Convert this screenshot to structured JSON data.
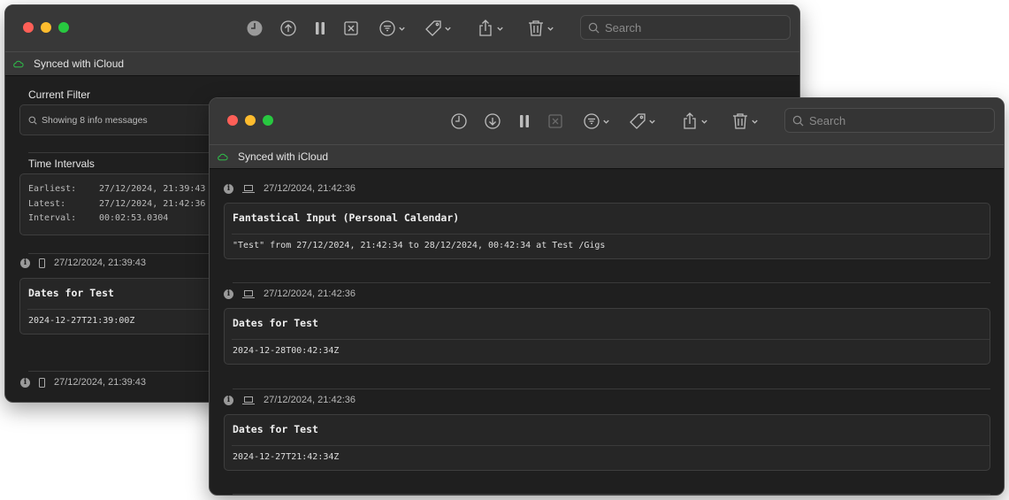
{
  "colors": {
    "sync_icon": "#2fbf4a",
    "close": "#fe5f57",
    "minimize": "#febc2e",
    "zoom": "#28c840"
  },
  "toolbar": {
    "icons": [
      "clock-icon",
      "upload-icon",
      "pause-icon",
      "clear-icon",
      "filter-icon",
      "tag-icon",
      "share-icon",
      "trash-icon"
    ],
    "search_placeholder": "Search"
  },
  "back_window": {
    "sync_status": "Synced with iCloud",
    "current_filter": {
      "label": "Current Filter",
      "text": "Showing 8 info messages"
    },
    "time_intervals": {
      "label": "Time Intervals",
      "rows": [
        {
          "k": "Earliest:",
          "v": "27/12/2024, 21:39:43"
        },
        {
          "k": "Latest:",
          "v": "27/12/2024, 21:42:36"
        },
        {
          "k": "Interval:",
          "v": "00:02:53.0304"
        }
      ]
    },
    "entries": [
      {
        "device": "phone-icon",
        "timestamp": "27/12/2024, 21:39:43",
        "title": "Dates for Test",
        "body": "2024-12-27T21:39:00Z"
      },
      {
        "device": "phone-icon",
        "timestamp": "27/12/2024, 21:39:43"
      }
    ]
  },
  "front_window": {
    "sync_status": "Synced with iCloud",
    "entries": [
      {
        "device": "laptop-icon",
        "timestamp": "27/12/2024, 21:42:36",
        "title": "Fantastical Input (Personal Calendar)",
        "body": "\"Test\" from 27/12/2024, 21:42:34 to 28/12/2024, 00:42:34 at Test  /Gigs"
      },
      {
        "device": "laptop-icon",
        "timestamp": "27/12/2024, 21:42:36",
        "title": "Dates for Test",
        "body": "2024-12-28T00:42:34Z"
      },
      {
        "device": "laptop-icon",
        "timestamp": "27/12/2024, 21:42:36",
        "title": "Dates for Test",
        "body": "2024-12-27T21:42:34Z"
      }
    ]
  }
}
